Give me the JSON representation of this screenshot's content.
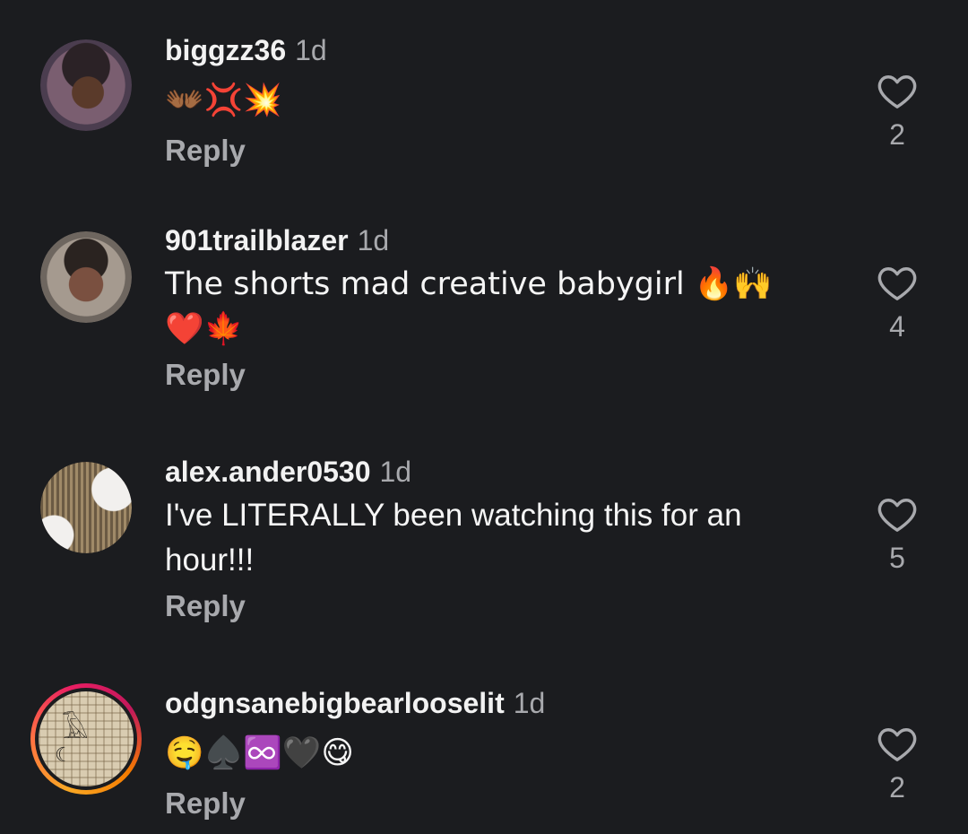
{
  "comments": [
    {
      "username": "biggzz36",
      "time": "1d",
      "text": "👐🏾💢💥",
      "reply_label": "Reply",
      "likes": "2"
    },
    {
      "username": "901trailblazer",
      "time": "1d",
      "text": "The shorts mad creative babygirl 🔥🙌❤️🍁",
      "reply_label": "Reply",
      "likes": "4"
    },
    {
      "username": "alex.ander0530",
      "time": "1d",
      "text": "I've LITERALLY been watching this for an hour!!!",
      "reply_label": "Reply",
      "likes": "5"
    },
    {
      "username": "odgnsanebigbearlooselit",
      "time": "1d",
      "text": "🤤♠️♾️🖤😋",
      "reply_label": "Reply",
      "likes": "2"
    }
  ],
  "colors": {
    "background": "#1b1c1f",
    "username": "#f2f2f2",
    "muted": "#a8a9ad",
    "story_ring_start": "#f9a825",
    "story_ring_end": "#e91e63"
  },
  "icons": {
    "like": "heart-outline-icon"
  }
}
